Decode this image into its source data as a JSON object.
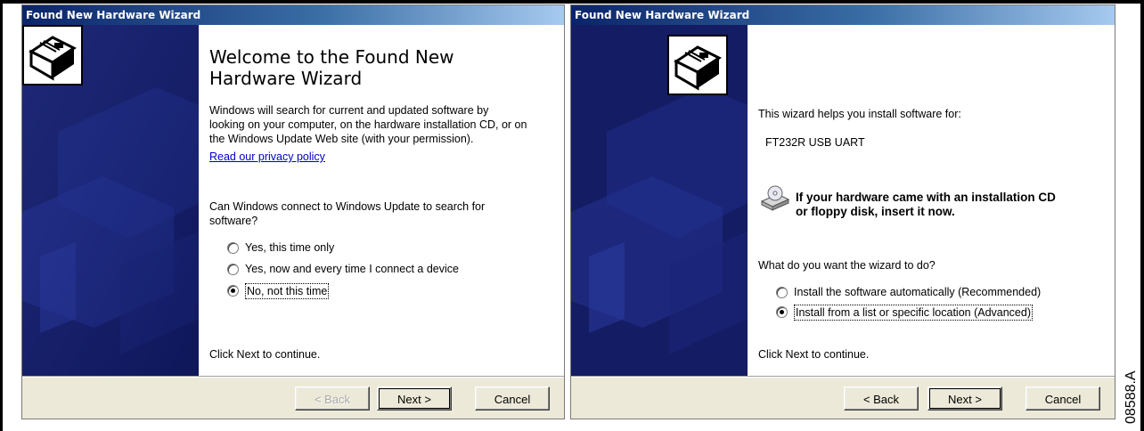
{
  "figure_code": "08588.A",
  "wizard1": {
    "title": "Found New Hardware Wizard",
    "heading_line1": "Welcome to the Found New",
    "heading_line2": "Hardware Wizard",
    "description_line1": "Windows will search for current and updated software by",
    "description_line2": "looking on your computer, on the hardware installation CD, or on",
    "description_line3": "the Windows Update Web site (with your permission).",
    "privacy_link": "Read our privacy policy",
    "question_line1": "Can Windows connect to Windows Update to search for",
    "question_line2": "software?",
    "options": [
      {
        "label": "Yes, this time only",
        "selected": false
      },
      {
        "label": "Yes, now and every time I connect a device",
        "selected": false
      },
      {
        "label": "No, not this time",
        "selected": true
      }
    ],
    "continue_text": "Click Next to continue.",
    "buttons": {
      "back": "< Back",
      "next": "Next >",
      "cancel": "Cancel"
    },
    "back_enabled": false
  },
  "wizard2": {
    "title": "Found New Hardware Wizard",
    "intro": "This wizard helps you install software for:",
    "device_name": "FT232R USB UART",
    "cd_notice_line1": "If your hardware came with an installation CD",
    "cd_notice_line2": "or floppy disk, insert it now.",
    "question": "What do you want the wizard to do?",
    "options": [
      {
        "label": "Install the software automatically (Recommended)",
        "selected": false
      },
      {
        "label": "Install from a list or specific location (Advanced)",
        "selected": true
      }
    ],
    "continue_text": "Click Next to continue.",
    "buttons": {
      "back": "< Back",
      "next": "Next >",
      "cancel": "Cancel"
    },
    "back_enabled": true
  },
  "colors": {
    "titlebar_start": "#0a246a",
    "sidebar": "#141c63",
    "dialog_face": "#ece9d8",
    "link": "#0000cc"
  },
  "icons": [
    "hardware-icon",
    "cd-drive-icon"
  ]
}
